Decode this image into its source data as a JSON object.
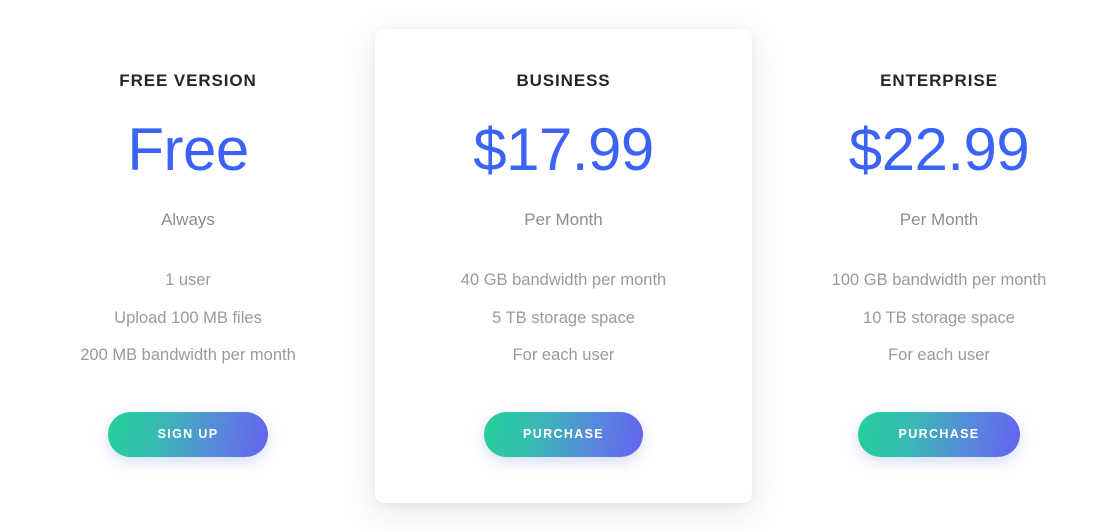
{
  "plans": [
    {
      "name": "FREE VERSION",
      "price": "Free",
      "period": "Always",
      "features": [
        "1 user",
        "Upload 100 MB files",
        "200 MB bandwidth per month"
      ],
      "cta_label": "SIGN UP",
      "featured": false
    },
    {
      "name": "BUSINESS",
      "price": "$17.99",
      "period": "Per Month",
      "features": [
        "40 GB bandwidth per month",
        "5 TB storage space",
        "For each user"
      ],
      "cta_label": "PURCHASE",
      "featured": true
    },
    {
      "name": "ENTERPRISE",
      "price": "$22.99",
      "period": "Per Month",
      "features": [
        "100 GB bandwidth per month",
        "10 TB storage space",
        "For each user"
      ],
      "cta_label": "PURCHASE",
      "featured": false
    }
  ],
  "colors": {
    "price_blue": "#3b63f6",
    "plan_name": "#24262b",
    "period_gray": "#8d8d90",
    "feature_gray": "#9a9a9d",
    "button_gradient_start": "#24cf9a",
    "button_gradient_end": "#6563ee",
    "card_background": "#ffffff",
    "page_background": "#ffffff"
  }
}
